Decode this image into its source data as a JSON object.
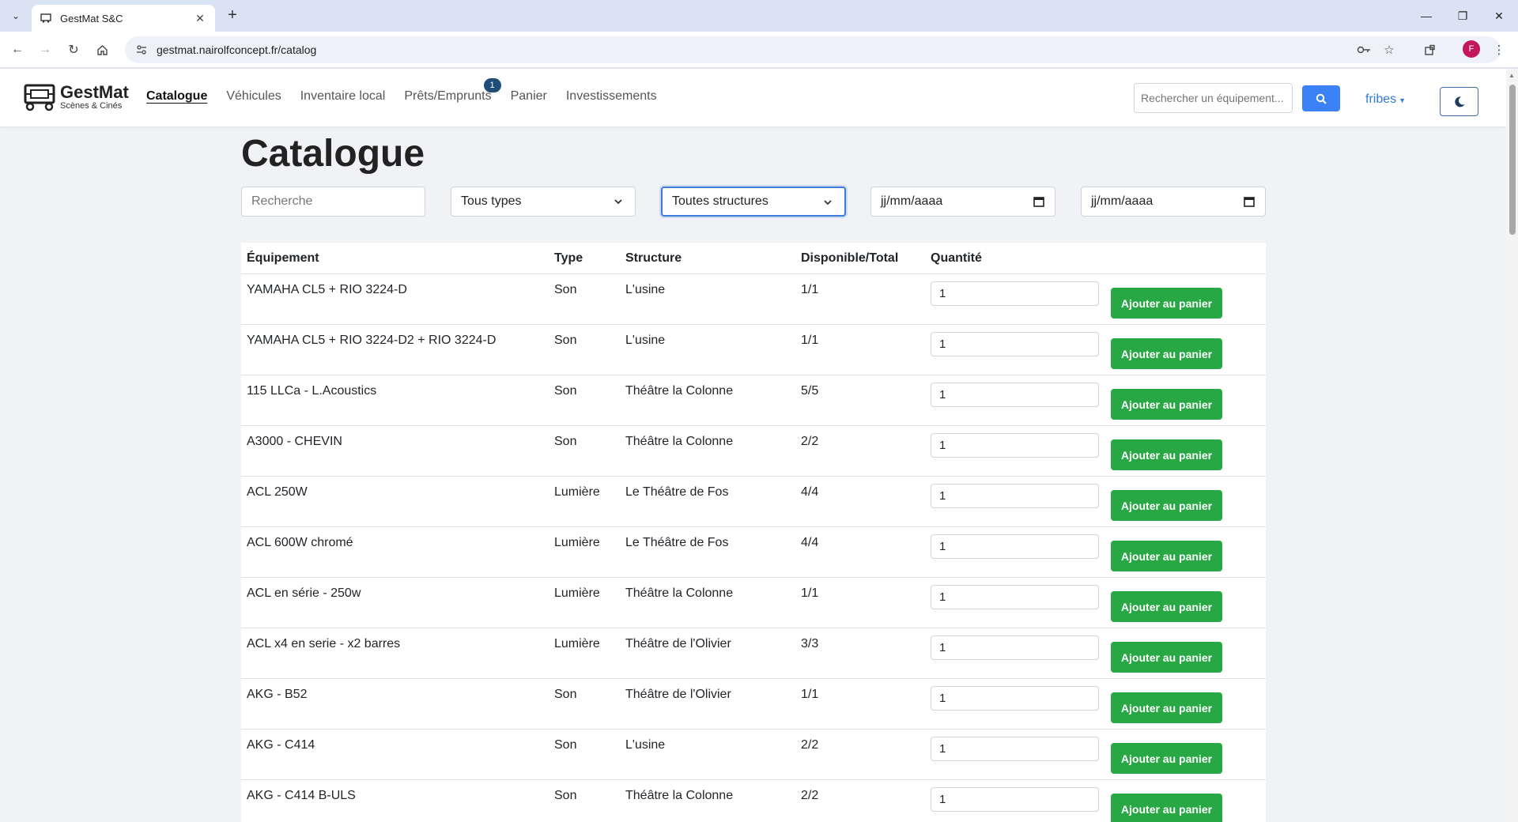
{
  "browser": {
    "tab_title": "GestMat S&C",
    "url": "gestmat.nairolfconcept.fr/catalog",
    "profile_initial": "F"
  },
  "app": {
    "brand_name": "GestMat",
    "brand_sub": "Scènes & Cinés",
    "nav": [
      {
        "label": "Catalogue"
      },
      {
        "label": "Véhicules"
      },
      {
        "label": "Inventaire local"
      },
      {
        "label": "Prêts/Emprunts",
        "badge": "1"
      },
      {
        "label": "Panier"
      },
      {
        "label": "Investissements"
      }
    ],
    "search_placeholder": "Rechercher un équipement...",
    "user": "fribes"
  },
  "catalog": {
    "title": "Catalogue",
    "filters": {
      "search_placeholder": "Recherche",
      "type_value": "Tous types",
      "structure_value": "Toutes structures",
      "date_start": "jj/mm/aaaa",
      "date_end": "jj/mm/aaaa"
    },
    "columns": [
      "Équipement",
      "Type",
      "Structure",
      "Disponible/Total",
      "Quantité"
    ],
    "add_label": "Ajouter au panier",
    "rows": [
      {
        "name": "YAMAHA CL5 + RIO 3224-D",
        "type": "Son",
        "structure": "L'usine",
        "avail": "1/1",
        "qty": "1"
      },
      {
        "name": "YAMAHA CL5 + RIO 3224-D2 + RIO 3224-D",
        "type": "Son",
        "structure": "L'usine",
        "avail": "1/1",
        "qty": "1"
      },
      {
        "name": "115 LLCa - L.Acoustics",
        "type": "Son",
        "structure": "Théâtre la Colonne",
        "avail": "5/5",
        "qty": "1"
      },
      {
        "name": "A3000 - CHEVIN",
        "type": "Son",
        "structure": "Théâtre la Colonne",
        "avail": "2/2",
        "qty": "1"
      },
      {
        "name": "ACL 250W",
        "type": "Lumière",
        "structure": "Le Théâtre de Fos",
        "avail": "4/4",
        "qty": "1"
      },
      {
        "name": "ACL 600W chromé",
        "type": "Lumière",
        "structure": "Le Théâtre de Fos",
        "avail": "4/4",
        "qty": "1"
      },
      {
        "name": "ACL en série - 250w",
        "type": "Lumière",
        "structure": "Théâtre la Colonne",
        "avail": "1/1",
        "qty": "1"
      },
      {
        "name": "ACL x4 en serie - x2 barres",
        "type": "Lumière",
        "structure": "Théâtre de l'Olivier",
        "avail": "3/3",
        "qty": "1"
      },
      {
        "name": "AKG - B52",
        "type": "Son",
        "structure": "Théâtre de l'Olivier",
        "avail": "1/1",
        "qty": "1"
      },
      {
        "name": "AKG - C414",
        "type": "Son",
        "structure": "L'usine",
        "avail": "2/2",
        "qty": "1"
      },
      {
        "name": "AKG - C414 B-ULS",
        "type": "Son",
        "structure": "Théâtre la Colonne",
        "avail": "2/2",
        "qty": "1"
      }
    ]
  }
}
